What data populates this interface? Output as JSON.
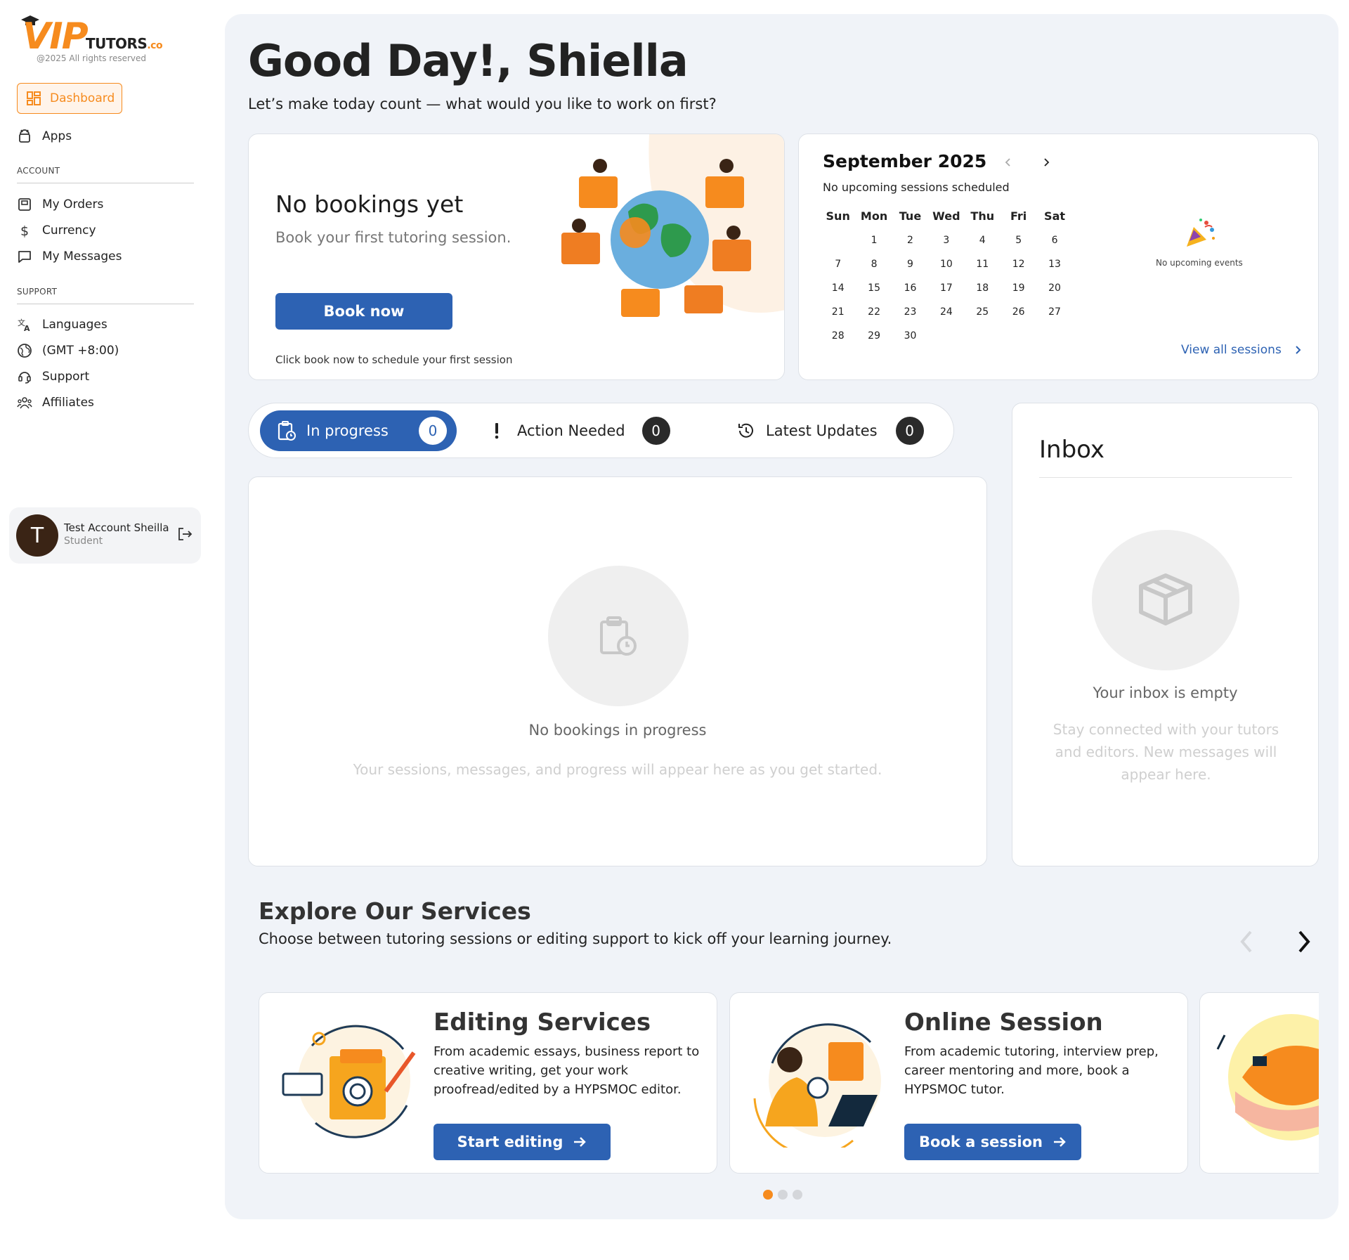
{
  "sidebar": {
    "brand": {
      "vip": "VIP",
      "tutors": "TUTORS",
      "tld": ".co",
      "copyright": "@2025 All rights reserved"
    },
    "nav": {
      "dashboard": "Dashboard",
      "apps": "Apps"
    },
    "account_label": "ACCOUNT",
    "account_items": [
      "My Orders",
      "Currency",
      "My Messages"
    ],
    "support_label": "SUPPORT",
    "support_items": [
      "Languages",
      "(GMT +8:00)",
      "Support",
      "Affiliates"
    ],
    "user": {
      "initial": "T",
      "name": "Test Account Sheilla",
      "role": "Student"
    }
  },
  "header": {
    "greeting": "Good Day!, Shiella",
    "subtitle": "Let’s make today count — what would you like to work on first?"
  },
  "booking_card": {
    "title": "No bookings yet",
    "subtitle": "Book your first tutoring session.",
    "button": "Book now",
    "hint": "Click book now to schedule your first session"
  },
  "calendar": {
    "month": "September 2025",
    "subtitle": "No upcoming sessions scheduled",
    "weekdays": [
      "Sun",
      "Mon",
      "Tue",
      "Wed",
      "Thu",
      "Fri",
      "Sat"
    ],
    "weeks": [
      [
        "",
        "1",
        "2",
        "3",
        "4",
        "5",
        "6"
      ],
      [
        "7",
        "8",
        "9",
        "10",
        "11",
        "12",
        "13"
      ],
      [
        "14",
        "15",
        "16",
        "17",
        "18",
        "19",
        "20"
      ],
      [
        "21",
        "22",
        "23",
        "24",
        "25",
        "26",
        "27"
      ],
      [
        "28",
        "29",
        "30",
        "",
        "",
        "",
        ""
      ]
    ],
    "no_events": "No upcoming events",
    "view_all": "View all sessions"
  },
  "tabs": [
    {
      "label": "In progress",
      "count": "0"
    },
    {
      "label": "Action Needed",
      "count": "0"
    },
    {
      "label": "Latest Updates",
      "count": "0"
    }
  ],
  "progress_panel": {
    "title": "No bookings in progress",
    "subtitle": "Your sessions, messages, and progress will appear here as you get started."
  },
  "inbox": {
    "title": "Inbox",
    "empty_title": "Your inbox is empty",
    "empty_subtitle": "Stay connected with your tutors and editors. New messages will appear here."
  },
  "services": {
    "title": "Explore Our Services",
    "subtitle": "Choose between tutoring sessions or editing support to kick off your learning journey.",
    "cards": [
      {
        "title": "Editing Services",
        "description": "From academic essays, business report to creative writing, get your work proofread/edited by a HYPSMOC editor.",
        "button": "Start editing"
      },
      {
        "title": "Online Session",
        "description": "From academic tutoring, interview prep, career mentoring and more, book a HYPSMOC tutor.",
        "button": "Book a session"
      }
    ],
    "active_page": 1,
    "page_count": 3
  },
  "colors": {
    "accent": "#f68b1e",
    "primary": "#2d62b3",
    "panel_bg": "#f0f3f8"
  }
}
